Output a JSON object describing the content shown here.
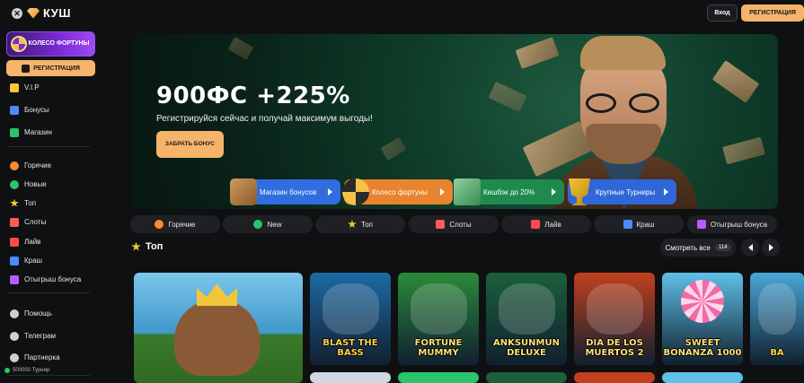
{
  "topbar": {
    "close_icon": "close-icon",
    "brand": "КУШ",
    "login_label": "Вход",
    "register_label": "РЕГИСТРАЦИЯ"
  },
  "sidebar": {
    "wheel_banner": "КОЛЕСО ФОРТУНЫ",
    "register_label": "РЕГИСТРАЦИЯ",
    "items": [
      {
        "label": "V.I.P",
        "icon": "crown-icon",
        "color": "#f5c53b"
      },
      {
        "label": "Бонусы",
        "icon": "gift-icon",
        "color": "#4a8cff"
      },
      {
        "label": "Магазин",
        "icon": "shop-icon",
        "color": "#29c46b"
      },
      {
        "label": "Горячие",
        "icon": "fire-icon",
        "color": "#ff8a2a"
      },
      {
        "label": "Новые",
        "icon": "new-icon",
        "color": "#29c46b"
      },
      {
        "label": "Топ",
        "icon": "star-icon",
        "color": "#f5c53b"
      },
      {
        "label": "Слоты",
        "icon": "slots-icon",
        "color": "#ff5a5a"
      },
      {
        "label": "Лайв",
        "icon": "live-icon",
        "color": "#ff4a4a"
      },
      {
        "label": "Краш",
        "icon": "plane-icon",
        "color": "#4a8cff"
      },
      {
        "label": "Отыгрыш бонуса",
        "icon": "wager-icon",
        "color": "#b45cff"
      },
      {
        "label": "Помощь",
        "icon": "headset-icon",
        "color": "#cfcfcf"
      },
      {
        "label": "Телеграм",
        "icon": "telegram-icon",
        "color": "#cfcfcf"
      },
      {
        "label": "Партнерка",
        "icon": "partner-icon",
        "color": "#cfcfcf"
      }
    ],
    "footer": "500000 Турнир"
  },
  "hero": {
    "title": "900ФС +225%",
    "subtitle": "Регистрируйся сейчас и получай максимум выгоды!",
    "button": "ЗАБРАТЬ БОНУС"
  },
  "promos": [
    {
      "label": "Магазин бонусов",
      "color": "#2f6de0"
    },
    {
      "label": "Колесо фортуны",
      "color": "#e8842e"
    },
    {
      "label": "Кешбэк до 20%",
      "color": "#1f8a4f"
    },
    {
      "label": "Крупные Турниры",
      "color": "#3067d8"
    }
  ],
  "categories": [
    {
      "label": "Горячие",
      "icon": "fire-icon",
      "color": "#ff8a2a"
    },
    {
      "label": "New",
      "icon": "new-icon",
      "color": "#29c46b"
    },
    {
      "label": "Топ",
      "icon": "star-icon",
      "color": "#f5c53b"
    },
    {
      "label": "Слоты",
      "icon": "slots-icon",
      "color": "#ff5a5a"
    },
    {
      "label": "Лайв",
      "icon": "live-icon",
      "color": "#ff4a4a"
    },
    {
      "label": "Краш",
      "icon": "plane-icon",
      "color": "#4a8cff"
    },
    {
      "label": "Отыгрыш бонуса",
      "icon": "wager-icon",
      "color": "#b45cff"
    }
  ],
  "section": {
    "title": "Топ",
    "see_all": "Смотреть все",
    "count": "114"
  },
  "games": [
    {
      "title": "",
      "bg": "#3f98c9"
    },
    {
      "title": "BLAST THE BASS",
      "bg": "#1d6aa6"
    },
    {
      "title": "FORTUNE MUMMY",
      "bg": "#2b8a3a"
    },
    {
      "title": "ANKSUNMUN DELUXE",
      "bg": "#1b5f3c"
    },
    {
      "title": "DIA DE LOS MUERTOS 2",
      "bg": "#c2401d"
    },
    {
      "title": "SWEET BONANZA 1000",
      "bg": "#5fc0e8"
    },
    {
      "title": "BA",
      "bg": "#4aa6d6"
    }
  ]
}
